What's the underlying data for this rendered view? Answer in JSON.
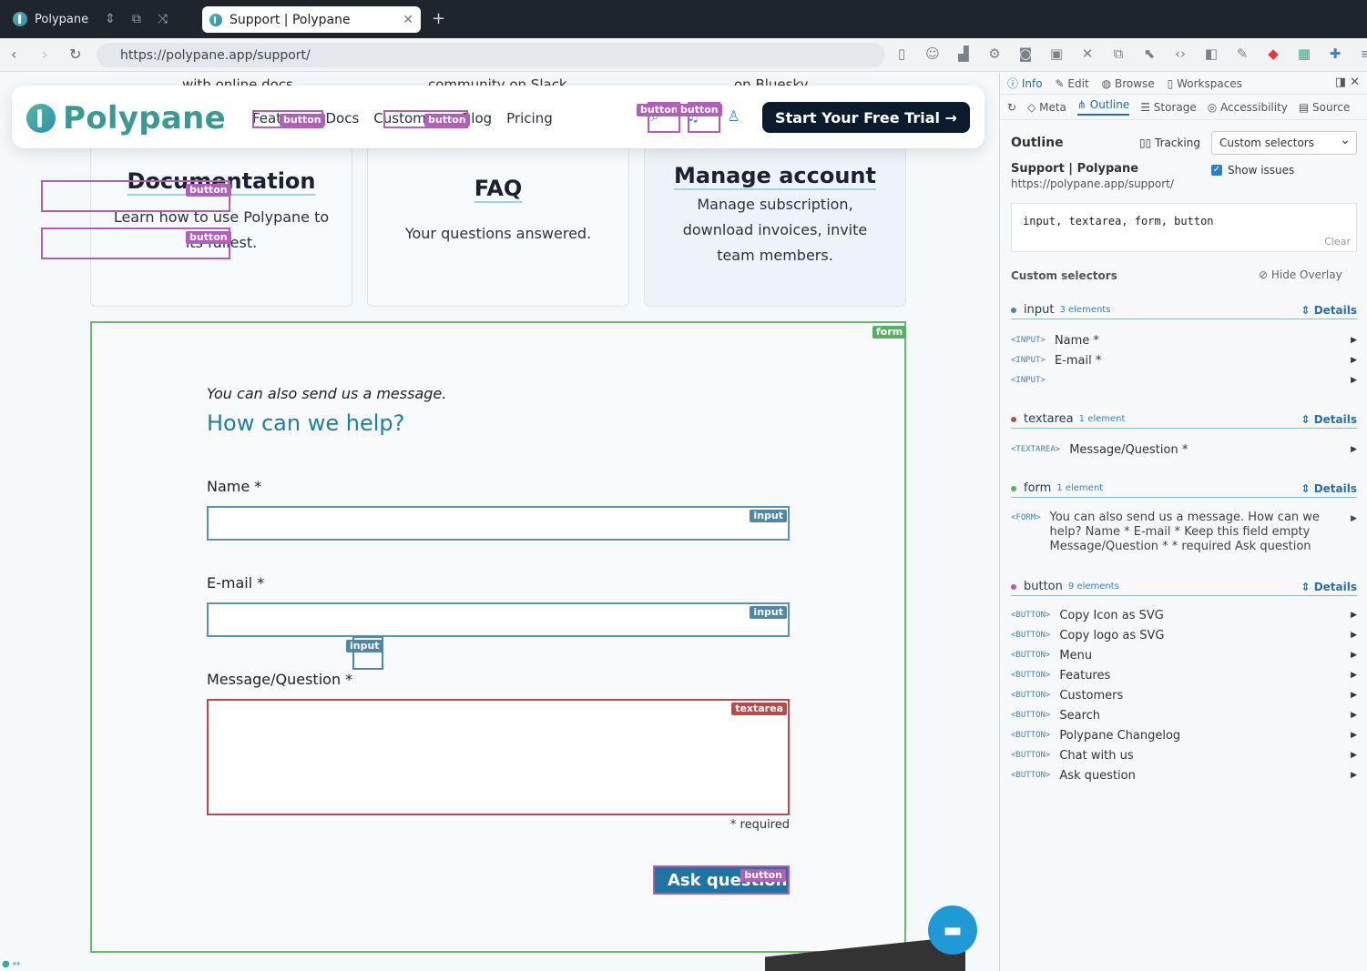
{
  "titlebar": {
    "app": "Polypane",
    "tab_title": "Support | Polypane",
    "tab_close": "✕",
    "new_tab": "+"
  },
  "address": {
    "url": "https://polypane.app/support/"
  },
  "cards": [
    {
      "title": "Documentation",
      "text": "Learn how to use Polypane to its fullest.",
      "cut": "with online docs"
    },
    {
      "title": "FAQ",
      "text": "Your questions answered.",
      "cut": "community on Slack"
    },
    {
      "title": "Manage account",
      "text": "Manage subscription, download invoices, invite team members.",
      "cut": "on Bluesky"
    }
  ],
  "header": {
    "brand": "Polypane",
    "nav": [
      "Features",
      "Docs",
      "Customers",
      "Blog",
      "Pricing"
    ],
    "cta": "Start Your Free Trial →"
  },
  "overlay": {
    "button": "button",
    "input": "input",
    "textarea": "textarea",
    "form": "form"
  },
  "form": {
    "intro": "You can also send us a message.",
    "title": "How can we help?",
    "name_label": "Name *",
    "email_label": "E-mail *",
    "message_label": "Message/Question *",
    "required": "* required",
    "submit": "Ask question"
  },
  "panel": {
    "tabs": [
      "Info",
      "Edit",
      "Browse",
      "Workspaces"
    ],
    "subtabs": [
      "Meta",
      "Outline",
      "Storage",
      "Accessibility",
      "Source"
    ],
    "section": "Outline",
    "tracking": "Tracking",
    "select": "Custom selectors",
    "page_title": "Support | Polypane",
    "page_url": "https://polypane.app/support/",
    "show_issues": "Show issues",
    "query": "input, textarea, form, button",
    "clear": "Clear",
    "custom_selectors": "Custom selectors",
    "hide_overlay": "Hide Overlay",
    "details": "Details",
    "groups": {
      "input": {
        "name": "input",
        "count": "3 elements",
        "color": "#4a82b0",
        "rows": [
          {
            "tag": "<INPUT>",
            "label": "Name *"
          },
          {
            "tag": "<INPUT>",
            "label": "E-mail *"
          },
          {
            "tag": "<INPUT>",
            "label": ""
          }
        ]
      },
      "textarea": {
        "name": "textarea",
        "count": "1 element",
        "color": "#b84a4a",
        "rows": [
          {
            "tag": "<TEXTAREA>",
            "label": "Message/Question *"
          }
        ]
      },
      "form": {
        "name": "form",
        "count": "1 element",
        "color": "#5aae63",
        "tag": "<FORM>",
        "text": "You can also send us a message. How can we help? Name * E-mail * Keep this field empty Message/Question * * required Ask question"
      },
      "button": {
        "name": "button",
        "count": "9 elements",
        "color": "#b060b8",
        "rows": [
          {
            "tag": "<BUTTON>",
            "label": "Copy Icon as SVG"
          },
          {
            "tag": "<BUTTON>",
            "label": "Copy logo as SVG"
          },
          {
            "tag": "<BUTTON>",
            "label": "Menu"
          },
          {
            "tag": "<BUTTON>",
            "label": "Features"
          },
          {
            "tag": "<BUTTON>",
            "label": "Customers"
          },
          {
            "tag": "<BUTTON>",
            "label": "Search"
          },
          {
            "tag": "<BUTTON>",
            "label": "Polypane Changelog"
          },
          {
            "tag": "<BUTTON>",
            "label": "Chat with us"
          },
          {
            "tag": "<BUTTON>",
            "label": "Ask question"
          }
        ]
      }
    }
  }
}
